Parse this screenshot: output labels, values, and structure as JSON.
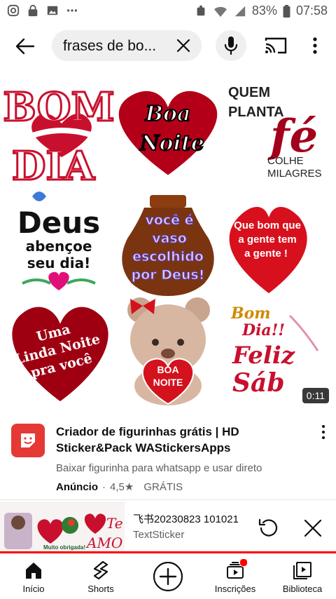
{
  "status_bar": {
    "battery": "83%",
    "time": "07:58",
    "left_icons": [
      "instagram-icon",
      "lock-icon",
      "image-icon",
      "more-dots-icon"
    ],
    "right_icons": [
      "alarm-icon",
      "wifi-icon",
      "signal-icon",
      "battery-icon"
    ]
  },
  "top_bar": {
    "search_query": "frases de bo...",
    "icons": [
      "back-arrow-icon",
      "clear-icon",
      "mic-icon",
      "cast-icon",
      "more-vert-icon"
    ]
  },
  "ad": {
    "stickers": [
      {
        "lines": [
          "BOM",
          "DIA"
        ]
      },
      {
        "lines": [
          "Boa",
          "Noite"
        ]
      },
      {
        "lines": [
          "QUEM",
          "PLANTA",
          "fé",
          "COLHE",
          "MILAGRES"
        ]
      },
      {
        "lines": [
          "Deus",
          "abençoe",
          "seu dia!"
        ]
      },
      {
        "lines": [
          "você é",
          "vaso",
          "escolhido",
          "por Deus!"
        ]
      },
      {
        "lines": [
          "Que bom que",
          "a gente tem",
          "a gente !"
        ]
      },
      {
        "lines": [
          "Uma",
          "Linda Noite",
          "pra você"
        ]
      },
      {
        "lines": [
          "BOA",
          "NOITE"
        ]
      },
      {
        "lines": [
          "Bom",
          "Dia!!",
          "Feliz",
          "Sáb"
        ]
      }
    ],
    "duration": "0:11",
    "title": "Criador de figurinhas grátis | HD Sticker&Pack WAStickersApps",
    "description": "Baixar figurinha para whatsapp e usar direto",
    "badge": "Anúncio",
    "rating": "4,5★",
    "price": "GRÁTIS"
  },
  "mini_player": {
    "title": "飞书20230823 101021",
    "channel": "TextSticker",
    "thumb_texts": [
      "Te",
      "AMO",
      "Muito obrigada!"
    ]
  },
  "nav": [
    {
      "label": "Início",
      "icon": "home-icon"
    },
    {
      "label": "Shorts",
      "icon": "shorts-icon"
    },
    {
      "label": "",
      "icon": "create-plus-icon"
    },
    {
      "label": "Inscrições",
      "icon": "subscriptions-icon"
    },
    {
      "label": "Biblioteca",
      "icon": "library-icon"
    }
  ],
  "colors": {
    "accent_red": "#ff0000",
    "sticker_red": "#c8102e",
    "app_icon": "#e53935"
  }
}
